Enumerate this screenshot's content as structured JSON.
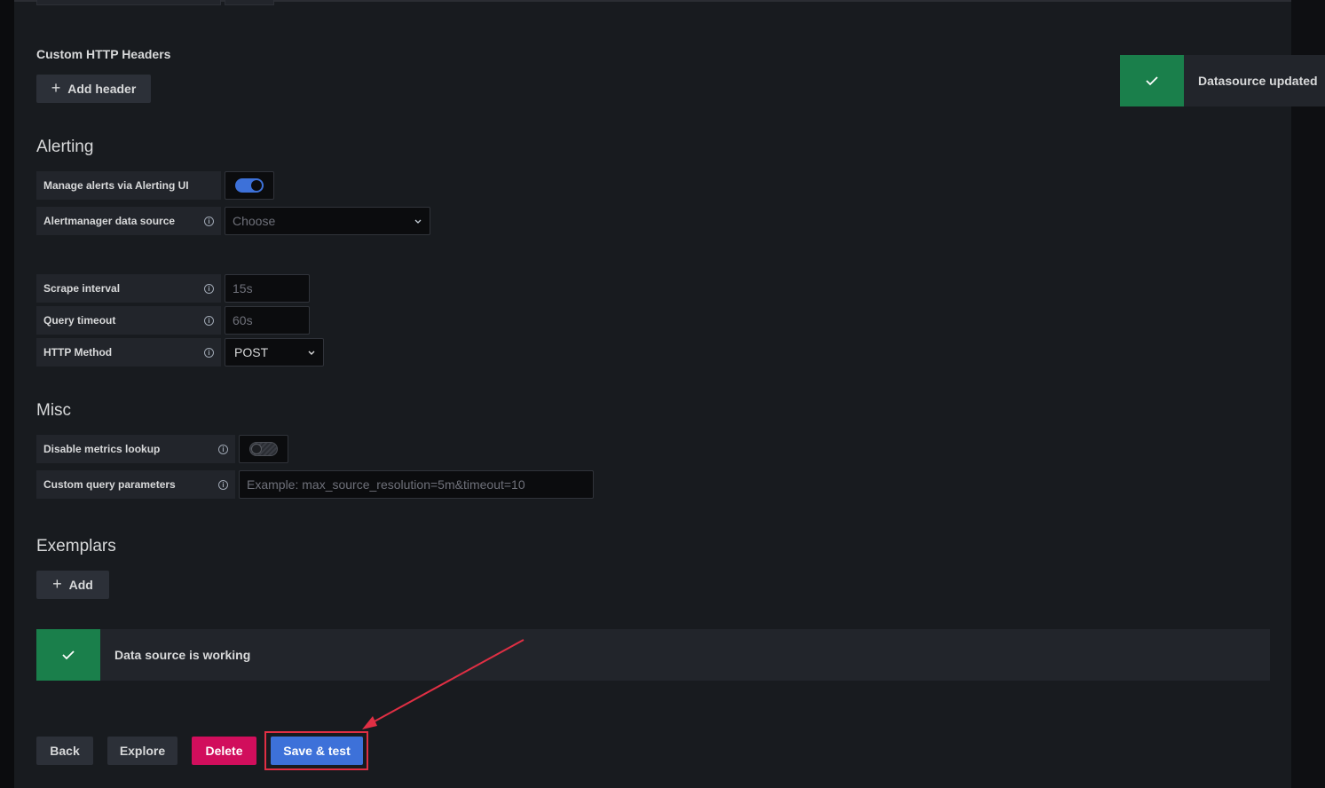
{
  "custom_headers": {
    "title": "Custom HTTP Headers",
    "add_button": "Add header",
    "add_icon": "plus-icon"
  },
  "alerting": {
    "title": "Alerting",
    "manage_alerts": {
      "label": "Manage alerts via Alerting UI",
      "enabled": true
    },
    "alertmanager": {
      "label": "Alertmanager data source",
      "placeholder": "Choose"
    }
  },
  "settings": {
    "scrape_interval": {
      "label": "Scrape interval",
      "placeholder": "15s"
    },
    "query_timeout": {
      "label": "Query timeout",
      "placeholder": "60s"
    },
    "http_method": {
      "label": "HTTP Method",
      "value": "POST"
    }
  },
  "misc": {
    "title": "Misc",
    "disable_metrics_lookup": {
      "label": "Disable metrics lookup",
      "enabled": false
    },
    "custom_query_params": {
      "label": "Custom query parameters",
      "placeholder": "Example: max_source_resolution=5m&timeout=10"
    }
  },
  "exemplars": {
    "title": "Exemplars",
    "add_button": "Add"
  },
  "status": {
    "message": "Data source is working",
    "icon": "check-icon"
  },
  "toast": {
    "message": "Datasource updated",
    "icon": "check-icon"
  },
  "actions": {
    "back": "Back",
    "explore": "Explore",
    "delete": "Delete",
    "save_test": "Save & test"
  },
  "colors": {
    "background": "#181b1f",
    "primary": "#3d71d9",
    "success": "#1a7f4b",
    "danger": "#d10e5c",
    "annotation": "#e02f44"
  }
}
